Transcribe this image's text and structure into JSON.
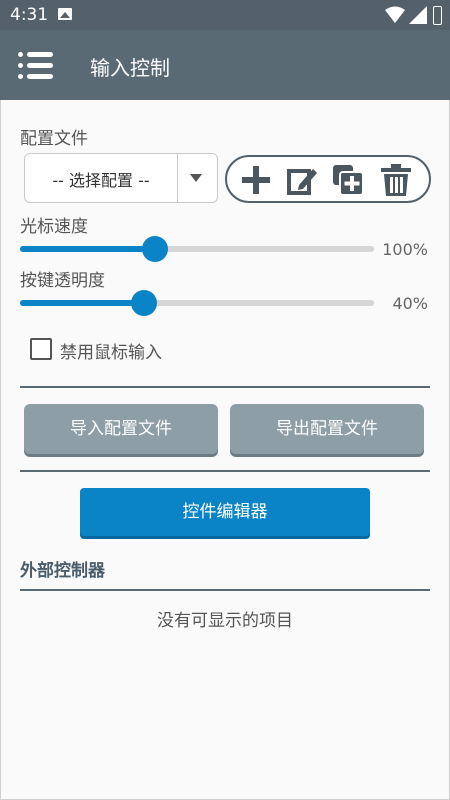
{
  "status_bar": {
    "time": "4:31"
  },
  "app_bar": {
    "title": "输入控制",
    "menu_icon": "menu-icon"
  },
  "config": {
    "label": "配置文件",
    "selected": "-- 选择配置 --",
    "actions": [
      "add-icon",
      "edit-icon",
      "duplicate-icon",
      "delete-icon"
    ]
  },
  "cursor_speed": {
    "label": "光标速度",
    "value_text": "100%",
    "level": 0.38
  },
  "key_opacity": {
    "label": "按键透明度",
    "value_text": "40%",
    "level": 0.35
  },
  "disable_mouse": {
    "label": "禁用鼠标输入",
    "checked": false
  },
  "buttons": {
    "import": "导入配置文件",
    "export": "导出配置文件",
    "editor": "控件编辑器"
  },
  "external": {
    "title": "外部控制器",
    "empty_text": "没有可显示的项目"
  },
  "colors": {
    "accent": "#0a84c7",
    "toolbar": "#5a6a75",
    "gray_button": "#8e9ea6"
  }
}
